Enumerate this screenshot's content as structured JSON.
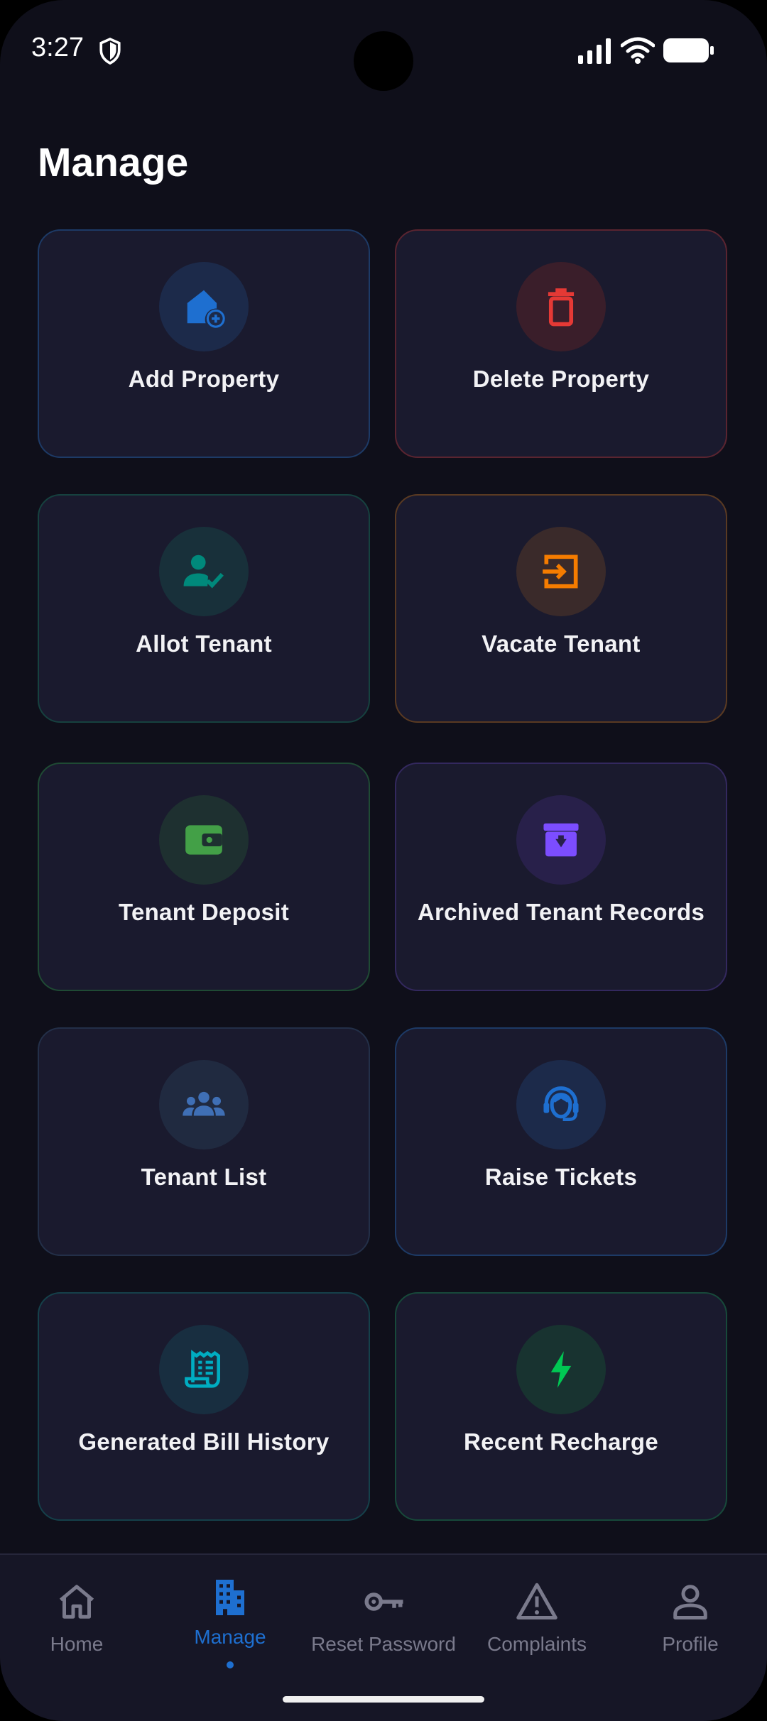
{
  "status_bar": {
    "time": "3:27"
  },
  "page": {
    "title": "Manage"
  },
  "cards": [
    {
      "label": "Add Property",
      "icon": "add-home-icon",
      "accent": "#1e6fd0"
    },
    {
      "label": "Delete Property",
      "icon": "trash-icon",
      "accent": "#e53935"
    },
    {
      "label": "Allot Tenant",
      "icon": "person-check-icon",
      "accent": "#00897b"
    },
    {
      "label": "Vacate Tenant",
      "icon": "exit-icon",
      "accent": "#f57c00"
    },
    {
      "label": "Tenant Deposit",
      "icon": "wallet-icon",
      "accent": "#43a047"
    },
    {
      "label": "Archived Tenant Records",
      "icon": "archive-icon",
      "accent": "#7c4dff"
    },
    {
      "label": "Tenant List",
      "icon": "group-icon",
      "accent": "#3f6fb5"
    },
    {
      "label": "Raise Tickets",
      "icon": "support-agent-icon",
      "accent": "#1e6fd0"
    },
    {
      "label": "Generated Bill History",
      "icon": "receipt-icon",
      "accent": "#00acc1"
    },
    {
      "label": "Recent Recharge",
      "icon": "bolt-icon",
      "accent": "#00c853"
    }
  ],
  "nav": {
    "items": [
      {
        "label": "Home",
        "icon": "home-icon"
      },
      {
        "label": "Manage",
        "icon": "building-icon",
        "active": true
      },
      {
        "label": "Reset Password",
        "icon": "key-icon"
      },
      {
        "label": "Complaints",
        "icon": "warning-icon"
      },
      {
        "label": "Profile",
        "icon": "person-icon"
      }
    ],
    "active_color": "#1e6fd0",
    "inactive_color": "#7a7a8c"
  }
}
